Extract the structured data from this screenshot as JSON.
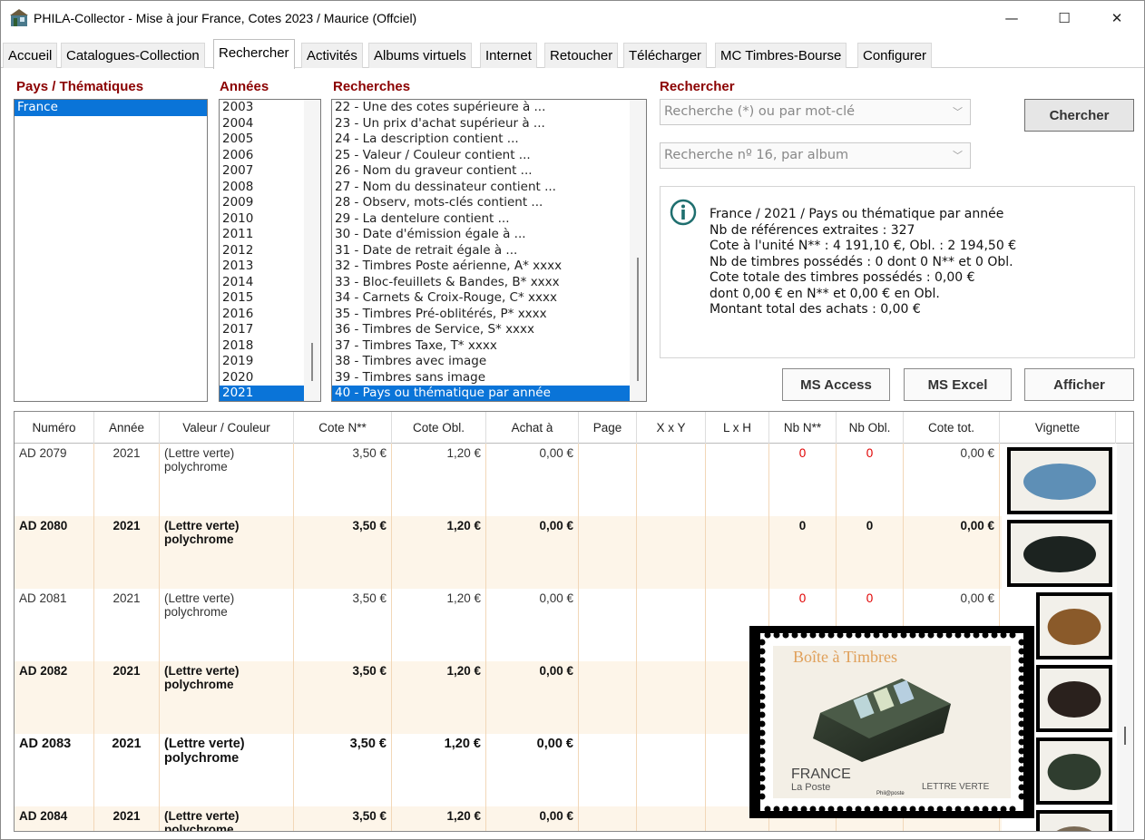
{
  "window": {
    "title": "PHILA-Collector - Mise à jour France, Cotes 2023 / Maurice (Offciel)",
    "minimize": "—",
    "maximize": "☐",
    "close": "✕"
  },
  "tabs": [
    {
      "label": "Accueil"
    },
    {
      "label": "Catalogues-Collection"
    },
    {
      "label": "Rechercher"
    },
    {
      "label": "Activités"
    },
    {
      "label": "Albums virtuels"
    },
    {
      "label": "Internet"
    },
    {
      "label": "Retoucher"
    },
    {
      "label": "Télécharger"
    },
    {
      "label": "MC Timbres-Bourse"
    },
    {
      "label": "Configurer"
    }
  ],
  "labels": {
    "pays": "Pays / Thématiques",
    "annees": "Années",
    "recherches": "Recherches",
    "rechercher": "Rechercher"
  },
  "pays_list": [
    "France"
  ],
  "annees_list": [
    "2003",
    "2004",
    "2005",
    "2006",
    "2007",
    "2008",
    "2009",
    "2010",
    "2011",
    "2012",
    "2013",
    "2014",
    "2015",
    "2016",
    "2017",
    "2018",
    "2019",
    "2020",
    "2021"
  ],
  "recherches_list": [
    "22 - Une des cotes supérieure à ...",
    "23 - Un prix d'achat supérieur à ...",
    "24 - La description contient ...",
    "25 - Valeur / Couleur contient ...",
    "26 - Nom du graveur contient ...",
    "27 - Nom du dessinateur contient ...",
    "28 - Observ, mots-clés contient ...",
    "29 - La dentelure contient ...",
    "30 - Date d'émission égale à ...",
    "31 - Date de retrait égale à ...",
    "32 - Timbres Poste aérienne, A* xxxx",
    "33 - Bloc-feuillets & Bandes, B* xxxx",
    "34 - Carnets & Croix-Rouge, C* xxxx",
    "35 - Timbres Pré-oblitérés, P* xxxx",
    "36 - Timbres de Service, S* xxxx",
    "37 - Timbres Taxe, T* xxxx",
    "38 - Timbres avec image",
    "39 - Timbres sans image",
    "40 - Pays ou thématique par année"
  ],
  "search": {
    "keyword_combo": "Recherche (*) ou par mot-clé",
    "album_combo": "Recherche nº 16, par album",
    "chercher": "Chercher"
  },
  "info": [
    "France / 2021 / Pays ou thématique par année",
    "Nb de références extraites : 327",
    "Cote à l'unité N** : 4 191,10 €, Obl. : 2 194,50 €",
    "Nb de timbres possédés : 0 dont 0 N** et 0 Obl.",
    "Cote totale des timbres possédés : 0,00 €",
    "dont 0,00 € en N** et 0,00 € en Obl.",
    "Montant total des achats : 0,00 €"
  ],
  "buttons": {
    "access": "MS Access",
    "excel": "MS Excel",
    "afficher": "Afficher"
  },
  "columns": [
    "Numéro",
    "Année",
    "Valeur / Couleur",
    "Cote N**",
    "Cote Obl.",
    "Achat à",
    "Page",
    "X x Y",
    "L x H",
    "Nb N**",
    "Nb Obl.",
    "Cote tot.",
    "Vignette"
  ],
  "rows": [
    {
      "numero": "AD 2079",
      "annee": "2021",
      "valeur1": "(Lettre verte)",
      "valeur2": "polychrome",
      "cote_n": "3,50 €",
      "cote_obl": "1,20 €",
      "achat": "0,00 €",
      "nb_n": "0",
      "nb_obl": "0",
      "cote_tot": "0,00 €"
    },
    {
      "numero": "AD 2080",
      "annee": "2021",
      "valeur1": "(Lettre verte)",
      "valeur2": "polychrome",
      "cote_n": "3,50 €",
      "cote_obl": "1,20 €",
      "achat": "0,00 €",
      "nb_n": "0",
      "nb_obl": "0",
      "cote_tot": "0,00 €"
    },
    {
      "numero": "AD 2081",
      "annee": "2021",
      "valeur1": "(Lettre verte)",
      "valeur2": "polychrome",
      "cote_n": "3,50 €",
      "cote_obl": "1,20 €",
      "achat": "0,00 €",
      "nb_n": "0",
      "nb_obl": "0",
      "cote_tot": "0,00 €"
    },
    {
      "numero": "AD 2082",
      "annee": "2021",
      "valeur1": "(Lettre verte)",
      "valeur2": "polychrome",
      "cote_n": "3,50 €",
      "cote_obl": "1,20 €",
      "achat": "0,00 €",
      "nb_n": "",
      "nb_obl": "",
      "cote_tot": ""
    },
    {
      "numero": "AD 2083",
      "annee": "2021",
      "valeur1": "(Lettre verte)",
      "valeur2": "polychrome",
      "cote_n": "3,50 €",
      "cote_obl": "1,20 €",
      "achat": "0,00 €",
      "nb_n": "",
      "nb_obl": "",
      "cote_tot": ""
    },
    {
      "numero": "AD 2084",
      "annee": "2021",
      "valeur1": "(Lettre verte)",
      "valeur2": "polychrome",
      "cote_n": "3,50 €",
      "cote_obl": "1,20 €",
      "achat": "0,00 €",
      "nb_n": "",
      "nb_obl": "",
      "cote_tot": ""
    }
  ],
  "stamp": {
    "title": "Boîte à Timbres",
    "country": "FRANCE",
    "poste": "La Poste",
    "phil": "Phil@poste",
    "tarif": "LETTRE VERTE"
  },
  "colors": {
    "accent_red": "#8b0000",
    "selection": "#0a74d8",
    "zero_red": "#e00000"
  }
}
